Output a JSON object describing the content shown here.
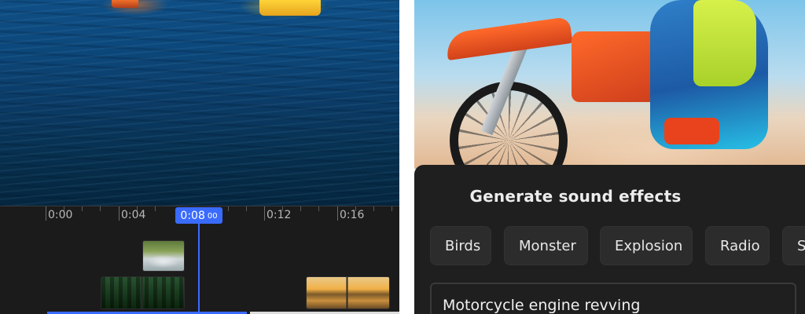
{
  "timeline": {
    "labels": [
      "0:00",
      "0:04",
      "0:12",
      "0:16"
    ],
    "playhead_time": "0:08",
    "playhead_frames": "00"
  },
  "sound_effects": {
    "title": "Generate sound effects",
    "chips": [
      "Birds",
      "Monster",
      "Explosion",
      "Radio",
      "S"
    ],
    "prompt_value": "Motorcycle engine revving"
  },
  "colors": {
    "accent": "#3a6bff",
    "panel_bg": "#1f1f1f",
    "chip_bg": "#2c2c2c",
    "timeline_bg": "#1b1b1b"
  },
  "icons": [
    "playhead-marker"
  ]
}
